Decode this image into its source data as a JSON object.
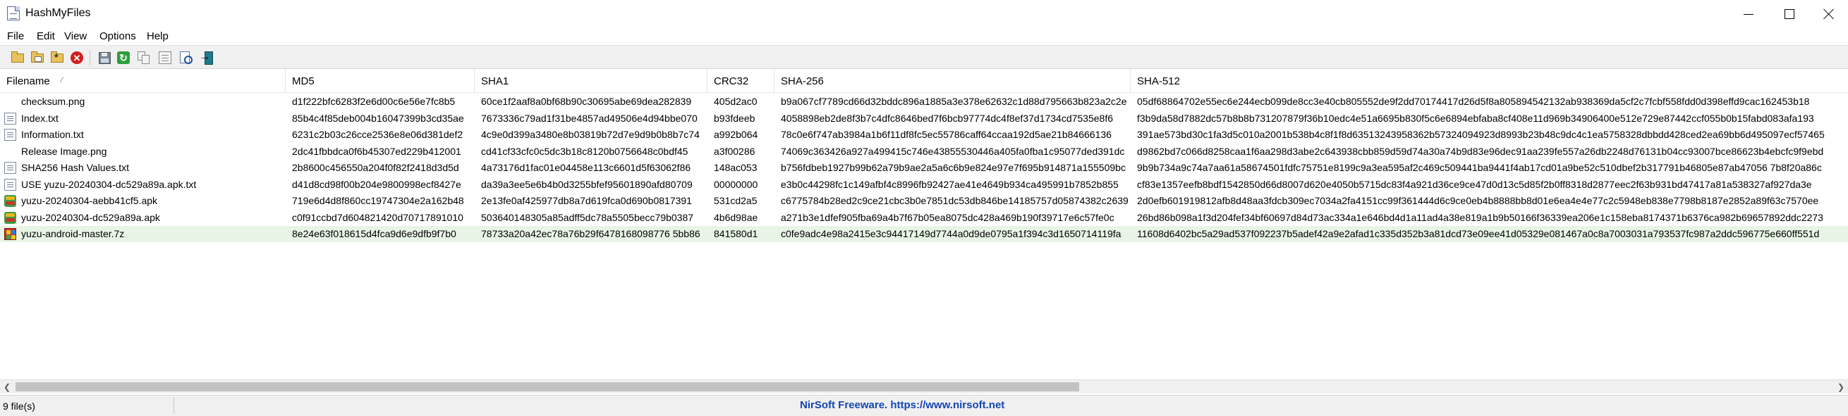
{
  "window": {
    "title": "HashMyFiles"
  },
  "menu": [
    "File",
    "Edit",
    "View",
    "Options",
    "Help"
  ],
  "toolbar": {
    "icons": [
      "open-folder-icon",
      "open-subfolder-icon",
      "wildcard-folder-icon",
      "stop-icon",
      "save-icon",
      "refresh-icon",
      "copy-icon",
      "properties-icon",
      "find-icon",
      "exit-icon"
    ]
  },
  "columns": [
    "Filename",
    "MD5",
    "SHA1",
    "CRC32",
    "SHA-256",
    "SHA-512"
  ],
  "files": [
    {
      "icon": "image",
      "filename": "checksum.png",
      "md5": "d1f222bfc6283f2e6d00c6e56e7fc8b5",
      "sha1": "60ce1f2aaf8a0bf68b90c30695abe69dea282839",
      "crc32": "405d2ac0",
      "sha256": "b9a067cf7789cd66d32bddc896a1885a3e378e62632c1d88d795663b823a2c2e",
      "sha512": "05df68864702e55ec6e244ecb099de8cc3e40cb805552de9f2dd70174417d26d5f8a805894542132ab938369da5cf2c7fcbf558fdd0d398effd9cac162453b18"
    },
    {
      "icon": "doc",
      "filename": "Index.txt",
      "md5": "85b4c4f85deb004b16047399b3cd35ae",
      "sha1": "7673336c79ad1f31be4857ad49506e4d94bbe070",
      "crc32": "b93fdeeb",
      "sha256": "4058898eb2de8f3b7c4dfc8646bed7f6bcb97774dc4f8ef37d1734cd7535e8f6",
      "sha512": "f3b9da58d7882dc57b8b8b731207879f36b10edc4e51a6695b830f5c6e6894ebfaba8cf408e11d969b34906400e512e729e87442ccf055b0b15fabd083afa193"
    },
    {
      "icon": "doc",
      "filename": "Information.txt",
      "md5": "6231c2b03c26cce2536e8e06d381def2",
      "sha1": "4c9e0d399a3480e8b03819b72d7e9d9b0b8b7c74",
      "crc32": "a992b064",
      "sha256": "78c0e6f747ab3984a1b6f11df8fc5ec55786caff64ccaa192d5ae21b84666136",
      "sha512": "391ae573bd30c1fa3d5c010a2001b538b4c8f1f8d63513243958362b57324094923d8993b23b48c9dc4c1ea5758328dbbdd428ced2ea69bb6d495097ecf57465"
    },
    {
      "icon": "image",
      "filename": "Release Image.png",
      "md5": "2dc41fbbdca0f6b45307ed229b412001",
      "sha1": "cd41cf33cfc0c5dc3b18c8120b0756648c0bdf45",
      "crc32": "a3f00286",
      "sha256": "74069c363426a927a499415c746e43855530446a405fa0fba1c95077ded391dc",
      "sha512": "d9862bd7c066d8258caa1f6aa298d3abe2c643938cbb859d59d74a30a74b9d83e96dec91aa239fe557a26db2248d76131b04cc93007bce86623b4ebcfc9f9ebd"
    },
    {
      "icon": "doc",
      "filename": "SHA256 Hash Values.txt",
      "md5": "2b8600c456550a204f0f82f2418d3d5d",
      "sha1": "4a73176d1fac01e04458e113c6601d5f63062f86",
      "crc32": "148ac053",
      "sha256": "b756fdbeb1927b99b62a79b9ae2a5a6c6b9e824e97e7f695b914871a155509bc",
      "sha512": "9b9b734a9c74a7aa61a58674501fdfc75751e8199c9a3ea595af2c469c509441ba9441f4ab17cd01a9be52c510dbef2b317791b46805e87ab47056 7b8f20a86c"
    },
    {
      "icon": "doc",
      "filename": "USE yuzu-20240304-dc529a89a.apk.txt",
      "md5": "d41d8cd98f00b204e9800998ecf8427e",
      "sha1": "da39a3ee5e6b4b0d3255bfef95601890afd80709",
      "crc32": "00000000",
      "sha256": "e3b0c44298fc1c149afbf4c8996fb92427ae41e4649b934ca495991b7852b855",
      "sha512": "cf83e1357eefb8bdf1542850d66d8007d620e4050b5715dc83f4a921d36ce9ce47d0d13c5d85f2b0ff8318d2877eec2f63b931bd47417a81a538327af927da3e"
    },
    {
      "icon": "apk",
      "filename": "yuzu-20240304-aebb41cf5.apk",
      "md5": "719e6d4d8f860cc19747304e2a162b48",
      "sha1": "2e13fe0af425977db8a7d619fca0d690b0817391",
      "crc32": "531cd2a5",
      "sha256": "c6775784b28ed2c9ce21cbc3b0e7851dc53db846be14185757d05874382c2639",
      "sha512": "2d0efb601919812afb8d48aa3fdcb309ec7034a2fa4151cc99f361444d6c9ce0eb4b8888bb8d01e6ea4e4e77c2c5948eb838e7798b8187e2852a89f63c7570ee"
    },
    {
      "icon": "apk",
      "filename": "yuzu-20240304-dc529a89a.apk",
      "md5": "c0f91ccbd7d604821420d70717891010",
      "sha1": "503640148305a85adff5dc78a5505becc79b0387",
      "crc32": "4b6d98ae",
      "sha256": "a271b3e1dfef905fba69a4b7f67b05ea8075dc428a469b190f39717e6c57fe0c",
      "sha512": "26bd86b098a1f3d204fef34bf60697d84d73ac334a1e646bd4d1a11ad4a38e819a1b9b50166f36339ea206e1c158eba8174371b6376ca982b69657892ddc2273"
    },
    {
      "icon": "7z",
      "filename": "yuzu-android-master.7z",
      "md5": "8e24e63f018615d4fca9d6e9dfb9f7b0",
      "sha1": "78733a20a42ec78a76b29f6478168098776 5bb86",
      "crc32": "841580d1",
      "sha256": "c0fe9adc4e98a2415e3c94417149d7744a0d9de0795a1f394c3d1650714119fa",
      "sha512": "11608d6402bc5a29ad537f092237b5adef42a9e2afad1c335d352b3a81dcd73e09ee41d05329e081467a0c8a7003031a793537fc987a2ddc596775e660ff551d"
    }
  ],
  "selected_row": 8,
  "status": {
    "count": "9 file(s)",
    "link": "NirSoft Freeware. https://www.nirsoft.net"
  }
}
